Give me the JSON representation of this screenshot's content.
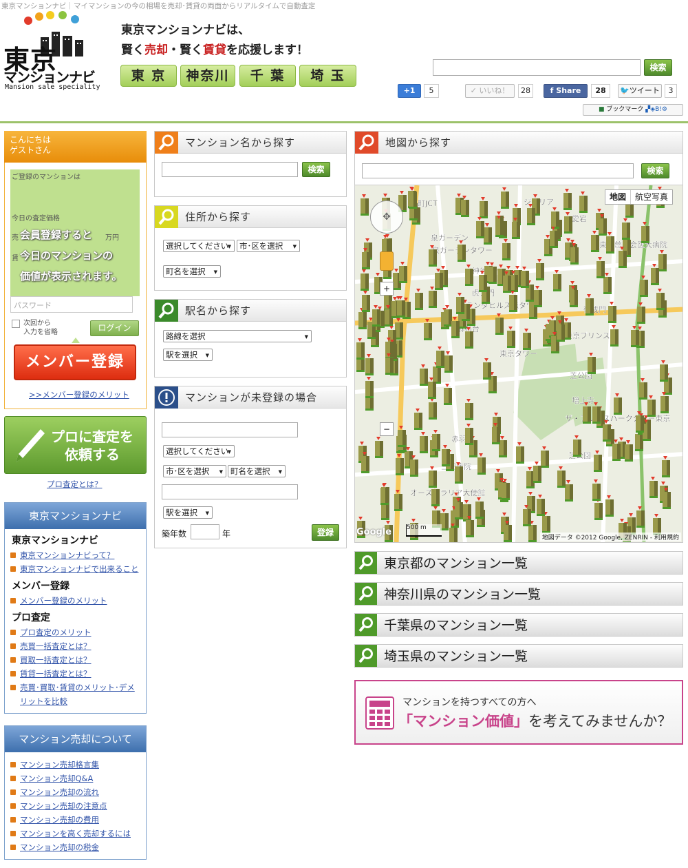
{
  "header": {
    "topline": "東京マンションナビ｜マイマンションの今の相場を売却･賃貸の両面からリアルタイムで自動査定",
    "logo_main": "東京",
    "logo_sub": "マンションナビ",
    "logo_eng": "Mansion sale speciality",
    "tagline1": "東京マンションナビは、",
    "tagline2a": "賢く",
    "tagline2b": "売却",
    "tagline2c": "・賢く",
    "tagline2d": "賃貸",
    "tagline2e": "を応援します！",
    "prefs": [
      "東 京",
      "神奈川",
      "千 葉",
      "埼 玉"
    ],
    "search_button": "検索",
    "social": {
      "gplus": "+1",
      "gplus_count": "5",
      "like": "いいね！",
      "like_count": "28",
      "share": "Share",
      "share_count": "28",
      "tweet": "ツイート",
      "tweet_count": "3",
      "bookmark": "ブックマーク"
    }
  },
  "sidebar": {
    "greeting1": "こんにちは",
    "greeting2": "ゲストさん",
    "registered_label": "ご登録のマンションは",
    "today_label": "今日の査定価格",
    "sell_label": "売",
    "rent_label": "賃",
    "yen": "万円",
    "overlay1": "会員登録すると",
    "overlay2": "今日のマンションの",
    "overlay3": "価値が表示されます。",
    "password_placeholder": "パスワード",
    "remember1": "次回から",
    "remember2": "入力を省略",
    "login": "ログイン",
    "member_register": "メンバー登録",
    "member_merit": ">>メンバー登録のメリット",
    "pro_line1": "プロに査定を",
    "pro_line2": "依頼する",
    "pro_what": "プロ査定とは？",
    "nav_title": "東京マンションナビ",
    "nav_sections": [
      {
        "title": "東京マンションナビ",
        "links": [
          "東京マンションナビって？",
          "東京マンションナビで出来ること"
        ]
      },
      {
        "title": "メンバー登録",
        "links": [
          "メンバー登録のメリット"
        ]
      },
      {
        "title": "プロ査定",
        "links": [
          "プロ査定のメリット",
          "売買一括査定とは？",
          "買取一括査定とは？",
          "賃貸一括査定とは？",
          "売買･買取･賃貸のメリット･デメ",
          "リットを比較"
        ]
      }
    ],
    "sale_title": "マンション売却について",
    "sale_links": [
      "マンション売却格言集",
      "マンション売却Q&A",
      "マンション売却の流れ",
      "マンション売却の注意点",
      "マンション売却の費用",
      "マンションを高く売却するには",
      "マンション売却の税金"
    ]
  },
  "middle": {
    "by_name": "マンション名から探す",
    "by_address": "住所から探す",
    "by_station": "駅名から探す",
    "unregistered": "マンションが未登録の場合",
    "search": "検索",
    "select_please": "選択してください",
    "select_city": "市･区を選択",
    "select_town": "町名を選択",
    "select_line": "路線を選択",
    "select_station": "駅を選択",
    "age_label": "築年数",
    "year": "年",
    "register": "登録"
  },
  "map": {
    "title": "地図から探す",
    "search": "検索",
    "btn_map": "地図",
    "btn_aerial": "航空写真",
    "labels": [
      "谷町JCT",
      "泉ガーデン",
      "泉ガーデンタワー",
      "神谷町",
      "虎ノ門",
      "オランダヒルズ森タワー",
      "麻布台",
      "東京タワー",
      "芝公園",
      "増上寺",
      "ザ・プリンスパークタワー東京",
      "赤羽橋",
      "三田病院",
      "御成門",
      "東京プリンスH",
      "愛宕",
      "東京慈恵会医大病院",
      "オーストラリア大使館",
      "芝公園",
      "ジェリア"
    ],
    "copyright": "地図データ ©2012 Google, ZENRIN - 利用規約",
    "scale": "500 m"
  },
  "lists": [
    "東京都のマンション一覧",
    "神奈川県のマンション一覧",
    "千葉県のマンション一覧",
    "埼玉県のマンション一覧"
  ],
  "cta": {
    "line1": "マンションを持つすべての方へ",
    "line2a": "「マンション価値」",
    "line2b": "を考えてみませんか？"
  }
}
